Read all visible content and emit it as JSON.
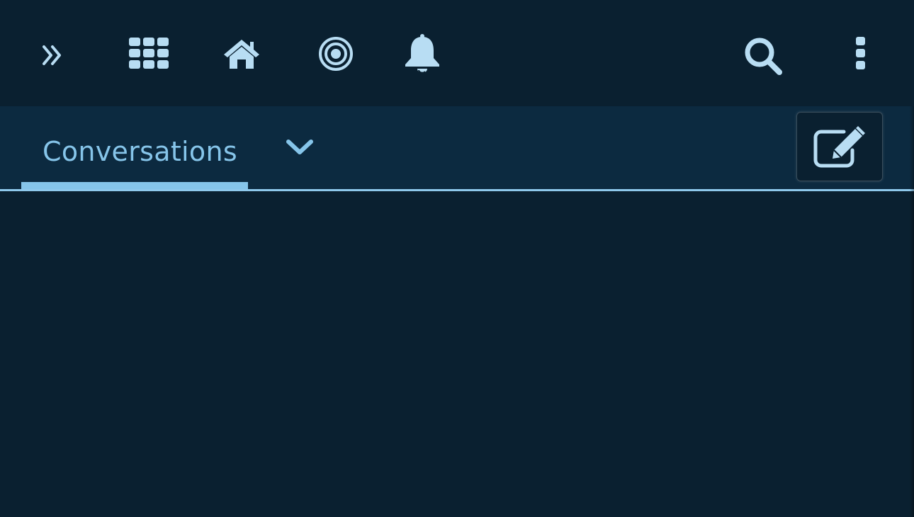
{
  "topbar": {
    "icons": {
      "expand": "double-chevron-right-icon",
      "apps": "grid-icon",
      "home": "home-icon",
      "activity": "target-icon",
      "notifications": "bell-icon",
      "search": "search-icon",
      "more": "vertical-ellipsis-icon"
    }
  },
  "subbar": {
    "active_tab_label": "Conversations",
    "dropdown_icon": "chevron-down-icon",
    "compose_icon": "edit-icon"
  },
  "colors": {
    "background": "#0a2030",
    "subbar_background": "#0c2a40",
    "accent": "#86c5ea",
    "icon": "#b8ddf3"
  }
}
